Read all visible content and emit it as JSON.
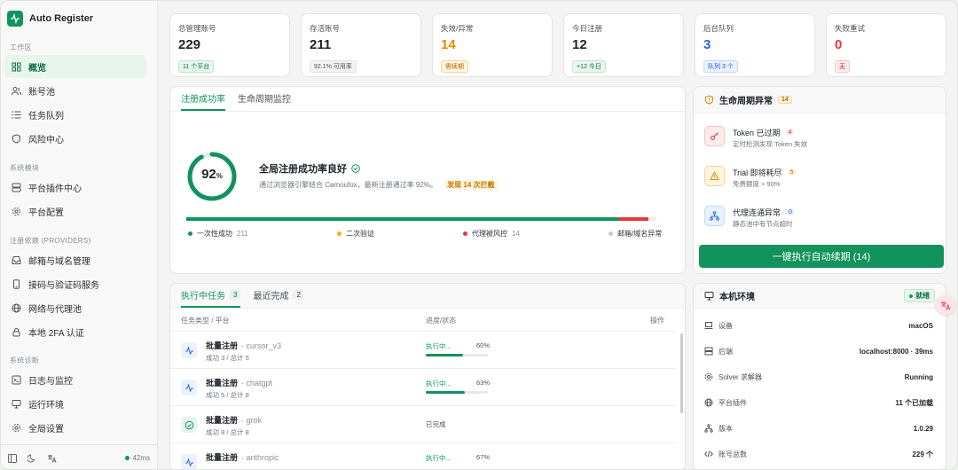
{
  "app": {
    "title": "Auto Register"
  },
  "sidebar": {
    "sections": [
      {
        "title": "工作区",
        "items": [
          {
            "label": "概览",
            "icon": "grid-icon",
            "active": true
          },
          {
            "label": "账号池",
            "icon": "users-icon"
          },
          {
            "label": "任务队列",
            "icon": "list-icon"
          },
          {
            "label": "风险中心",
            "icon": "shield-icon"
          }
        ]
      },
      {
        "title": "系统模块",
        "items": [
          {
            "label": "平台插件中心",
            "icon": "server-icon"
          },
          {
            "label": "平台配置",
            "icon": "gear-icon"
          }
        ]
      },
      {
        "title": "注册依赖 (PROVIDERS)",
        "items": [
          {
            "label": "邮箱与域名管理",
            "icon": "inbox-icon"
          },
          {
            "label": "接码与验证码服务",
            "icon": "phone-icon"
          },
          {
            "label": "网络与代理池",
            "icon": "globe-icon"
          },
          {
            "label": "本地 2FA 认证",
            "icon": "lock-icon"
          }
        ]
      },
      {
        "title": "系统诊断",
        "items": [
          {
            "label": "日志与监控",
            "icon": "terminal-icon"
          },
          {
            "label": "运行环境",
            "icon": "monitor-icon"
          },
          {
            "label": "全局设置",
            "icon": "settings-icon"
          }
        ]
      }
    ],
    "footer": {
      "latency": "42ms"
    }
  },
  "stats": [
    {
      "label": "总管理账号",
      "value": "229",
      "badge": "11 个平台",
      "tone": "green"
    },
    {
      "label": "存活账号",
      "value": "211",
      "badge": "92.1% 可用率",
      "tone": "gray"
    },
    {
      "label": "失效/异常",
      "value": "14",
      "badge": "需续期",
      "tone": "orange"
    },
    {
      "label": "今日注册",
      "value": "12",
      "badge": "+12 今日",
      "tone": "green"
    },
    {
      "label": "后台队列",
      "value": "3",
      "badge": "队列 3 个",
      "tone": "blue"
    },
    {
      "label": "失败重试",
      "value": "0",
      "badge": "无",
      "tone": "red"
    }
  ],
  "success": {
    "tabs": [
      "注册成功率",
      "生命周期监控"
    ],
    "ring_value": "92",
    "ring_unit": "%",
    "rate": 0.92,
    "heading": "全局注册成功率良好",
    "description": "通过浏览器引擎结合 Camoufox，最新注册通过率 92%。",
    "highlight": "发现 14 次拦截",
    "legend": [
      {
        "label": "一次性成功",
        "count": "211",
        "color": "#12935e"
      },
      {
        "label": "二次验证",
        "count": "",
        "color": "#f2b01e"
      },
      {
        "label": "代理被风控",
        "count": "14",
        "color": "#e5383b"
      },
      {
        "label": "邮箱/域名异常",
        "count": "",
        "color": "#c4c8cc"
      }
    ],
    "bar": {
      "success": 211,
      "blocked": 14,
      "total": 229
    }
  },
  "lifecycle": {
    "title": "生命周期异常",
    "count": "14",
    "items": [
      {
        "title": "Token 已过期",
        "count": "4",
        "subtitle": "定时检测发现 Token 失效",
        "icon": "key-icon",
        "tone": "red"
      },
      {
        "title": "Trial 即将耗尽",
        "count": "5",
        "subtitle": "免费额度 > 90%",
        "icon": "warning-icon",
        "tone": "orange"
      },
      {
        "title": "代理连通异常",
        "count": "0",
        "subtitle": "静态池中有节点超时",
        "icon": "network-icon",
        "tone": "blue"
      }
    ],
    "action": "一键执行自动续期 (14)"
  },
  "tasks": {
    "tabs": [
      {
        "label": "执行中任务",
        "count": "3"
      },
      {
        "label": "最近完成",
        "count": "2"
      }
    ],
    "columns": [
      "任务类型 / 平台",
      "进度/状态",
      "操作"
    ],
    "rows": [
      {
        "title": "批量注册",
        "platform": "· cursor_v3",
        "meta": "成功 3 / 总计 5",
        "status": "执行中...",
        "pct": "60%",
        "progress": 0.6,
        "icon": "activity-icon"
      },
      {
        "title": "批量注册",
        "platform": "· chatgpt",
        "meta": "成功 5 / 总计 8",
        "status": "执行中...",
        "pct": "63%",
        "progress": 0.63,
        "icon": "activity-icon"
      },
      {
        "title": "批量注册",
        "platform": "· grok",
        "meta": "成功 8 / 总计 8",
        "status": "已完成",
        "pct": "",
        "progress": 1,
        "icon": "check-circle-icon"
      },
      {
        "title": "批量注册",
        "platform": "· anthropic",
        "meta": "",
        "status": "执行中...",
        "pct": "67%",
        "progress": 0.67,
        "icon": "activity-icon"
      }
    ]
  },
  "env": {
    "title": "本机环境",
    "status": "就绪",
    "rows": [
      {
        "label": "设备",
        "value": "macOS",
        "icon": "laptop-icon"
      },
      {
        "label": "后端",
        "value": "localhost:8000 · 39ms",
        "icon": "server-icon"
      },
      {
        "label": "Solver 求解器",
        "value": "Running",
        "icon": "gear-icon"
      },
      {
        "label": "平台插件",
        "value": "11 个已加载",
        "icon": "globe-icon"
      },
      {
        "label": "版本",
        "value": "1.0.29",
        "icon": "network-icon"
      },
      {
        "label": "账号总数",
        "value": "229 个",
        "icon": "code-icon"
      }
    ]
  },
  "colors": {
    "accent": "#12935e",
    "danger": "#e5383b",
    "warning": "#e08a00",
    "info": "#2563eb"
  }
}
